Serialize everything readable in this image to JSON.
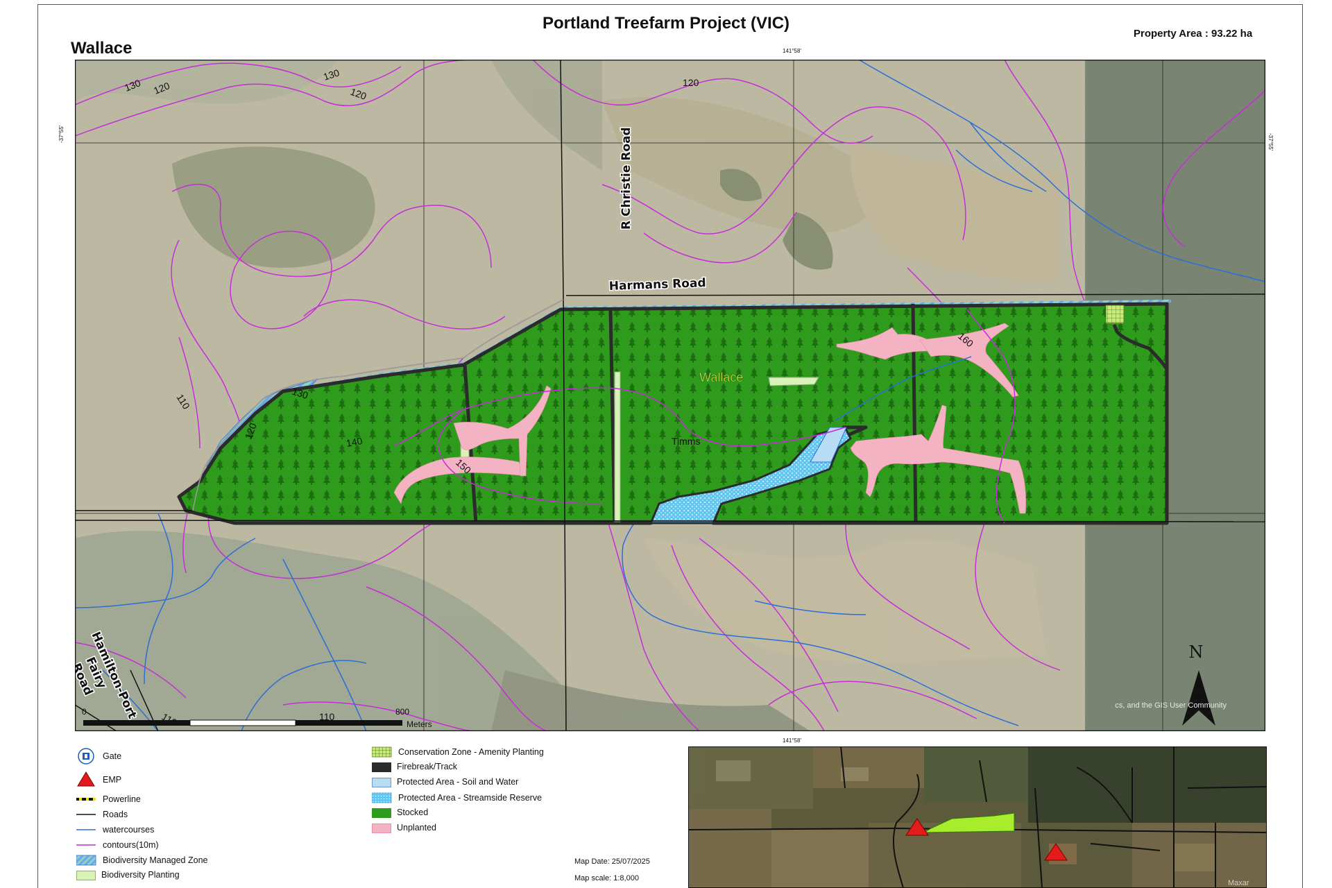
{
  "header": {
    "title": "Portland Treefarm Project (VIC)",
    "subtitle": "Wallace",
    "property_area": "Property Area : 93.22 ha"
  },
  "map": {
    "graticule": {
      "top_lon": "141°58'",
      "bottom_lon": "141°58'",
      "left_lat": "-37°55'",
      "right_lat": "-37°55'"
    },
    "roads": {
      "christie": "R Christie Road",
      "harmans": "Harmans Road",
      "hamilton": [
        "Hamilton-Port",
        "Fairy",
        "Road"
      ]
    },
    "labels": {
      "block": "Wallace",
      "creek": "Timms"
    },
    "contour_labels": [
      "130",
      "120",
      "130",
      "120",
      "120",
      "110",
      "130",
      "120",
      "140",
      "150",
      "160",
      "110",
      "110"
    ],
    "scale": {
      "start": "0",
      "end": "800",
      "unit": "Meters"
    },
    "north": "N",
    "attribution": "cs, and the GIS User Community",
    "colors": {
      "stocked": "#2e9b1d",
      "unplanted": "#f4b3c2",
      "firebreak": "#2b2b2b",
      "contour": "#c62dd8",
      "watercourse": "#2a6fd6",
      "protected_soil": "#b9dcf5",
      "streamside": "#63c6ef",
      "biodiversity_planting": "#d8f2b8",
      "conservation": "#b7e26a"
    }
  },
  "legend": {
    "col1": [
      {
        "icon": "gate-icon",
        "label": "Gate"
      },
      {
        "icon": "emp-triangle-icon",
        "label": "EMP"
      },
      {
        "icon": "powerline-icon",
        "label": "Powerline"
      },
      {
        "icon": "road-line-icon",
        "label": "Roads"
      },
      {
        "icon": "watercourse-line-icon",
        "label": "watercourses"
      },
      {
        "icon": "contour-line-icon",
        "label": "contours(10m)"
      },
      {
        "icon": "hatch-swatch-icon",
        "label": "Biodiversity Managed Zone"
      },
      {
        "icon": "light-green-swatch-icon",
        "label": "Biodiversity Planting"
      }
    ],
    "col2": [
      {
        "icon": "grid-swatch-icon",
        "label": "Conservation Zone - Amenity Planting"
      },
      {
        "icon": "dark-swatch-icon",
        "label": "Firebreak/Track"
      },
      {
        "icon": "light-blue-swatch-icon",
        "label": "Protected Area - Soil and Water"
      },
      {
        "icon": "dotted-blue-swatch-icon",
        "label": "Protected Area - Streamside Reserve"
      },
      {
        "icon": "green-swatch-icon",
        "label": "Stocked"
      },
      {
        "icon": "pink-swatch-icon",
        "label": "Unplanted"
      }
    ]
  },
  "info": {
    "map_date": "Map Date: 25/07/2025",
    "map_scale": "Map scale: 1:8,000"
  },
  "inset": {
    "watermark": "Maxar"
  }
}
